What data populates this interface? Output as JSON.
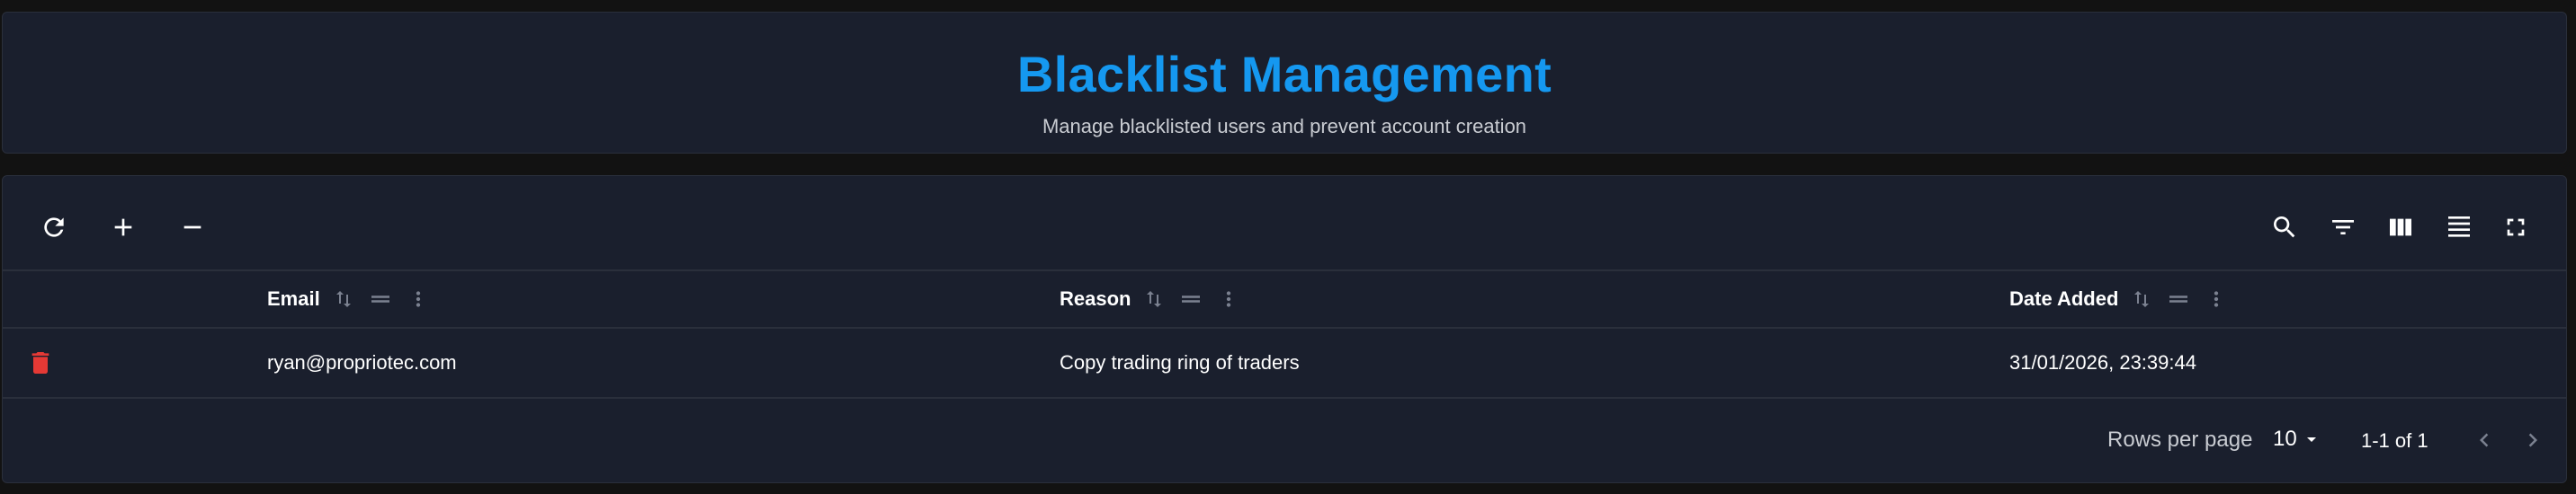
{
  "header": {
    "title": "Blacklist Management",
    "subtitle": "Manage blacklisted users and prevent account creation"
  },
  "toolbar": {
    "left_icons": [
      "refresh-icon",
      "plus-icon",
      "minus-icon"
    ],
    "right_icons": [
      "search-icon",
      "filter-icon",
      "columns-icon",
      "density-icon",
      "fullscreen-icon"
    ]
  },
  "table": {
    "columns": [
      {
        "label": "Email"
      },
      {
        "label": "Reason"
      },
      {
        "label": "Date Added"
      }
    ],
    "rows": [
      {
        "email": "ryan@propriotec.com",
        "reason": "Copy trading ring of traders",
        "date_added": "31/01/2026, 23:39:44"
      }
    ]
  },
  "pagination": {
    "rows_per_page_label": "Rows per page",
    "rows_per_page_value": "10",
    "range": "1-1 of 1"
  },
  "colors": {
    "background": "#121212",
    "card": "#1a1f2d",
    "accent": "#1598f0",
    "delete": "#e53935"
  }
}
